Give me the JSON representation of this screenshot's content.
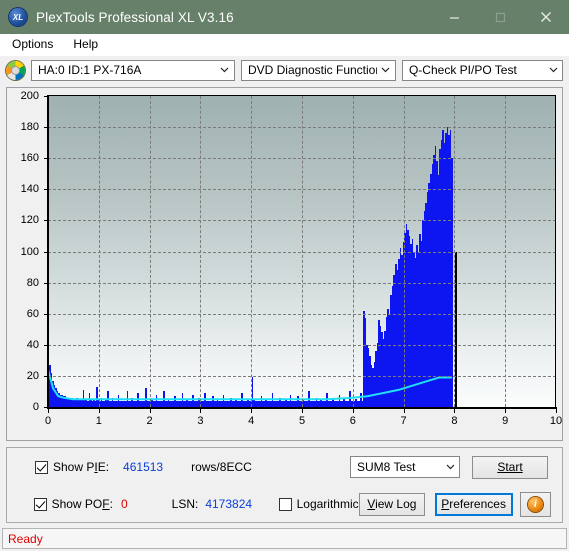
{
  "window": {
    "title": "PlexTools Professional XL V3.16",
    "app_icon": "xl-logo-icon",
    "minimize": "minimize-icon",
    "maximize": "maximize-icon",
    "close": "close-icon"
  },
  "menu": {
    "items": [
      "Options",
      "Help"
    ]
  },
  "toolbar": {
    "drive_icon": "optical-disc-icon",
    "drive": "HA:0 ID:1  PX-716A",
    "function": "DVD Diagnostic Functions",
    "test": "Q-Check PI/PO Test"
  },
  "controls": {
    "show_pie_label": "Show PIE:",
    "show_pie_checked": true,
    "pie_value": "461513",
    "pie_units": "rows/8ECC",
    "show_pof_label": "Show POF:",
    "show_pof_checked": true,
    "pof_value": "0",
    "lsn_label": "LSN:",
    "lsn_value": "4173824",
    "logarithmic_label": "Logarithmic",
    "logarithmic_checked": false,
    "test_mode": "SUM8 Test",
    "start_button": "Start",
    "view_log_button": "View Log",
    "preferences_button": "Preferences",
    "info_button": "i"
  },
  "status": {
    "text": "Ready"
  },
  "colors": {
    "titlebar": "#67806a",
    "pie_bar": "#0d16f0",
    "pof_line": "#20e0f8",
    "accent_focus": "#0078d7",
    "status_text": "#e00000",
    "value_blue": "#0a3fd8"
  },
  "chart_data": {
    "type": "bar",
    "title": "",
    "xlabel": "",
    "ylabel": "",
    "xlim": [
      0,
      10
    ],
    "ylim": [
      0,
      200
    ],
    "grid": true,
    "legend": "none",
    "xticks": [
      0,
      1,
      2,
      3,
      4,
      5,
      6,
      7,
      8,
      9,
      10
    ],
    "yticks": [
      0,
      20,
      40,
      60,
      80,
      100,
      120,
      140,
      160,
      180,
      200
    ],
    "data_end_x": 7.95,
    "end_marker_y": 100,
    "series": [
      {
        "name": "PIE",
        "color": "#0d16f0",
        "type": "bar",
        "x": [
          0.02,
          0.05,
          0.08,
          0.11,
          0.14,
          0.17,
          0.2,
          0.23,
          0.26,
          0.29,
          0.32,
          0.35,
          0.38,
          0.41,
          0.44,
          0.47,
          0.5,
          0.53,
          0.56,
          0.59,
          0.62,
          0.65,
          0.68,
          0.71,
          0.74,
          0.77,
          0.8,
          0.83,
          0.86,
          0.89,
          0.92,
          0.95,
          0.98,
          1.01,
          1.04,
          1.07,
          1.1,
          1.13,
          1.16,
          1.19,
          1.22,
          1.25,
          1.28,
          1.31,
          1.34,
          1.37,
          1.4,
          1.43,
          1.46,
          1.49,
          1.52,
          1.55,
          1.58,
          1.61,
          1.64,
          1.67,
          1.7,
          1.73,
          1.76,
          1.79,
          1.82,
          1.85,
          1.88,
          1.91,
          1.94,
          1.97,
          2.0,
          2.03,
          2.06,
          2.09,
          2.12,
          2.15,
          2.18,
          2.21,
          2.24,
          2.27,
          2.3,
          2.33,
          2.36,
          2.39,
          2.42,
          2.45,
          2.48,
          2.51,
          2.54,
          2.57,
          2.6,
          2.63,
          2.66,
          2.69,
          2.72,
          2.75,
          2.78,
          2.81,
          2.84,
          2.87,
          2.9,
          2.93,
          2.96,
          2.99,
          3.02,
          3.05,
          3.08,
          3.11,
          3.14,
          3.17,
          3.2,
          3.23,
          3.26,
          3.29,
          3.32,
          3.35,
          3.38,
          3.41,
          3.44,
          3.47,
          3.5,
          3.53,
          3.56,
          3.59,
          3.62,
          3.65,
          3.68,
          3.71,
          3.74,
          3.77,
          3.8,
          3.83,
          3.86,
          3.89,
          3.92,
          3.95,
          3.98,
          4.01,
          4.04,
          4.07,
          4.1,
          4.13,
          4.16,
          4.19,
          4.22,
          4.25,
          4.28,
          4.31,
          4.34,
          4.37,
          4.4,
          4.43,
          4.46,
          4.49,
          4.52,
          4.55,
          4.58,
          4.61,
          4.64,
          4.67,
          4.7,
          4.73,
          4.76,
          4.79,
          4.82,
          4.85,
          4.88,
          4.91,
          4.94,
          4.97,
          5.0,
          5.03,
          5.06,
          5.09,
          5.12,
          5.15,
          5.18,
          5.21,
          5.24,
          5.27,
          5.3,
          5.33,
          5.36,
          5.39,
          5.42,
          5.45,
          5.48,
          5.51,
          5.54,
          5.57,
          5.6,
          5.63,
          5.66,
          5.69,
          5.72,
          5.75,
          5.78,
          5.81,
          5.84,
          5.87,
          5.9,
          5.93,
          5.96,
          5.99,
          6.02,
          6.05,
          6.08,
          6.11,
          6.14,
          6.17,
          6.2,
          6.23,
          6.26,
          6.29,
          6.32,
          6.35,
          6.38,
          6.41,
          6.44,
          6.47,
          6.5,
          6.53,
          6.56,
          6.59,
          6.62,
          6.65,
          6.68,
          6.71,
          6.74,
          6.77,
          6.8,
          6.83,
          6.86,
          6.89,
          6.92,
          6.95,
          6.98,
          7.01,
          7.04,
          7.07,
          7.1,
          7.13,
          7.16,
          7.19,
          7.22,
          7.25,
          7.28,
          7.31,
          7.34,
          7.37,
          7.4,
          7.43,
          7.46,
          7.49,
          7.52,
          7.55,
          7.58,
          7.61,
          7.64,
          7.67,
          7.7,
          7.73,
          7.76,
          7.79,
          7.82,
          7.85,
          7.88,
          7.91,
          7.94
        ],
        "values": [
          27,
          22,
          17,
          14,
          12,
          10,
          9,
          8,
          8,
          7,
          7,
          6,
          6,
          6,
          5,
          6,
          5,
          5,
          6,
          5,
          5,
          5,
          11,
          5,
          5,
          4,
          9,
          5,
          4,
          5,
          4,
          13,
          5,
          4,
          6,
          4,
          4,
          5,
          10,
          4,
          4,
          6,
          4,
          4,
          4,
          8,
          4,
          4,
          4,
          4,
          4,
          10,
          4,
          4,
          6,
          4,
          4,
          4,
          9,
          4,
          4,
          4,
          4,
          12,
          4,
          4,
          4,
          5,
          4,
          4,
          8,
          4,
          4,
          4,
          4,
          10,
          4,
          4,
          5,
          4,
          4,
          4,
          7,
          4,
          4,
          4,
          4,
          9,
          4,
          4,
          5,
          4,
          4,
          4,
          8,
          4,
          4,
          4,
          6,
          4,
          4,
          4,
          9,
          4,
          4,
          4,
          4,
          7,
          4,
          4,
          5,
          4,
          4,
          4,
          8,
          4,
          4,
          4,
          4,
          6,
          4,
          4,
          5,
          4,
          4,
          4,
          9,
          4,
          4,
          4,
          5,
          4,
          4,
          19,
          5,
          4,
          4,
          4,
          4,
          7,
          4,
          4,
          5,
          4,
          4,
          4,
          9,
          4,
          4,
          4,
          4,
          6,
          4,
          4,
          4,
          5,
          4,
          4,
          8,
          4,
          4,
          4,
          4,
          7,
          4,
          4,
          5,
          4,
          4,
          4,
          10,
          4,
          4,
          4,
          4,
          6,
          4,
          4,
          5,
          4,
          4,
          4,
          9,
          4,
          4,
          4,
          5,
          4,
          4,
          4,
          8,
          4,
          4,
          5,
          4,
          4,
          4,
          10,
          4,
          4,
          4,
          5,
          4,
          4,
          9,
          4,
          62,
          57,
          40,
          38,
          33,
          27,
          25,
          29,
          36,
          41,
          56,
          52,
          48,
          44,
          49,
          58,
          63,
          60,
          72,
          78,
          85,
          92,
          88,
          95,
          102,
          98,
          106,
          112,
          118,
          114,
          110,
          105,
          108,
          100,
          96,
          104,
          99,
          111,
          107,
          120,
          126,
          131,
          138,
          144,
          150,
          156,
          162,
          168,
          158,
          149,
          166,
          172,
          178,
          170,
          176,
          180,
          175,
          178,
          160,
          120,
          12,
          10,
          11,
          9,
          10,
          8,
          9,
          7,
          8,
          6
        ]
      },
      {
        "name": "POF",
        "color": "#20e0f8",
        "type": "line",
        "x": [
          0.0,
          0.1,
          0.2,
          0.3,
          0.5,
          0.8,
          1.2,
          1.6,
          2.0,
          2.5,
          3.0,
          3.5,
          4.0,
          4.5,
          5.0,
          5.5,
          6.0,
          6.3,
          6.6,
          6.9,
          7.1,
          7.3,
          7.5,
          7.7,
          7.95
        ],
        "values": [
          24,
          12,
          7,
          6,
          5,
          5,
          5,
          5,
          5,
          5,
          5,
          5,
          5,
          5,
          5,
          5,
          6,
          7,
          9,
          11,
          13,
          15,
          17,
          19,
          19
        ]
      }
    ]
  }
}
